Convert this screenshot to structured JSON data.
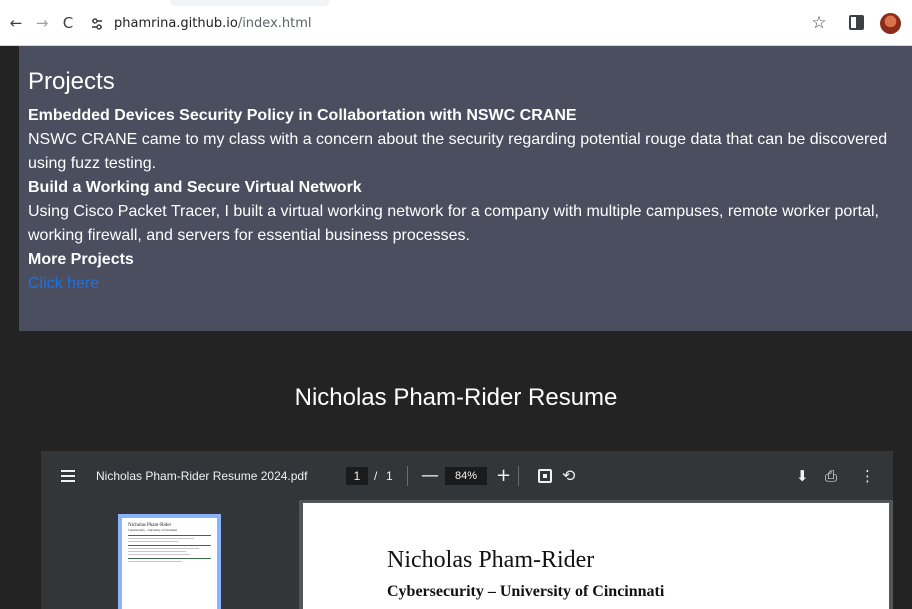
{
  "browser": {
    "back_glyph": "←",
    "forward_glyph": "→",
    "reload_glyph": "C",
    "url_host": "phamrina.github.io",
    "url_path": "/index.html",
    "star_glyph": "☆"
  },
  "projects": {
    "heading": "Projects",
    "items": [
      {
        "title": "Embedded Devices Security Policy in Collabortation with NSWC CRANE",
        "description": "NSWC CRANE came to my class with a concern about the security regarding potential rouge data that can be discovered using fuzz testing."
      },
      {
        "title": "Build a Working and Secure Virtual Network",
        "description": "Using Cisco Packet Tracer, I built a virtual working network for a company with multiple campuses, remote worker portal, working firewall, and servers for essential business processes."
      }
    ],
    "more_title": "More Projects",
    "link_label": "Click here",
    "link_color": "#1a73e8"
  },
  "resume": {
    "heading": "Nicholas Pham-Rider Resume",
    "viewer": {
      "file_name": "Nicholas Pham-Rider Resume 2024.pdf",
      "page_current": "1",
      "page_sep": "/",
      "page_total": "1",
      "zoom": "84%",
      "minus": "—",
      "plus": "+",
      "rotate": "⟲",
      "download": "⬇",
      "print": "⎙",
      "more": "⋮",
      "thumb_name": "Nicholas Pham-Rider",
      "thumb_sub": "Cybersecurity – University of Cincinnati"
    },
    "page": {
      "name": "Nicholas Pham-Rider",
      "subtitle": "Cybersecurity – University of Cincinnati"
    }
  }
}
